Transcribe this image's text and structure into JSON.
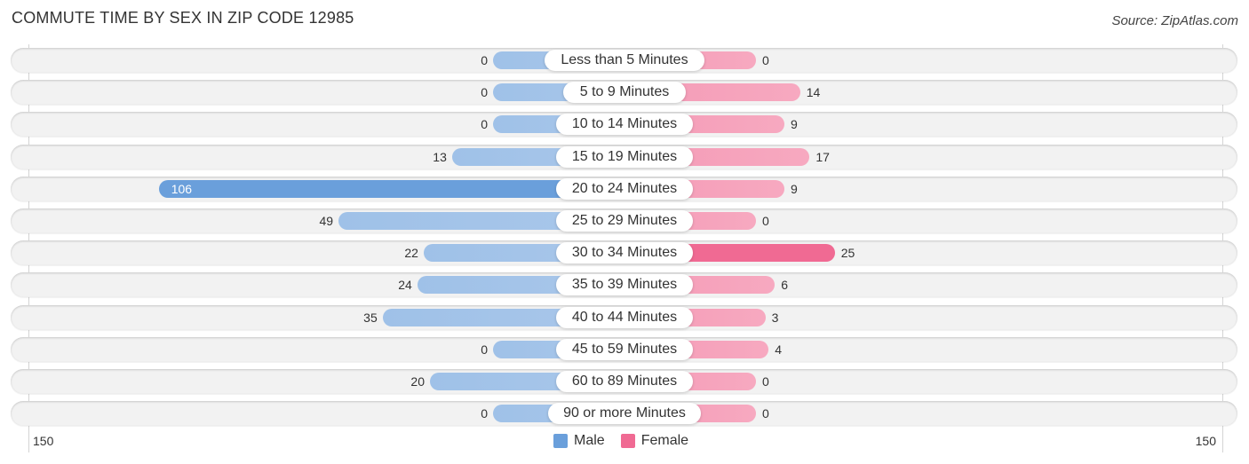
{
  "title": "COMMUTE TIME BY SEX IN ZIP CODE 12985",
  "source": "Source: ZipAtlas.com",
  "colors": {
    "male": "#6a9fdb",
    "female": "#f06a93",
    "male_light": "#a9c7ea",
    "female_light": "#f7a9c0"
  },
  "chart_data": {
    "type": "bar",
    "orientation": "horizontal-diverging",
    "title": "COMMUTE TIME BY SEX IN ZIP CODE 12985",
    "categories": [
      "Less than 5 Minutes",
      "5 to 9 Minutes",
      "10 to 14 Minutes",
      "15 to 19 Minutes",
      "20 to 24 Minutes",
      "25 to 29 Minutes",
      "30 to 34 Minutes",
      "35 to 39 Minutes",
      "40 to 44 Minutes",
      "45 to 59 Minutes",
      "60 to 89 Minutes",
      "90 or more Minutes"
    ],
    "series": [
      {
        "name": "Male",
        "values": [
          0,
          0,
          0,
          13,
          106,
          49,
          22,
          24,
          35,
          0,
          20,
          0
        ]
      },
      {
        "name": "Female",
        "values": [
          0,
          14,
          9,
          17,
          9,
          0,
          25,
          6,
          3,
          4,
          0,
          0
        ]
      }
    ],
    "axis_ticks": {
      "left": "150",
      "right": "150"
    },
    "xlim": [
      150,
      150
    ],
    "legend": {
      "position": "bottom-center",
      "entries": [
        "Male",
        "Female"
      ]
    },
    "grid": false
  }
}
